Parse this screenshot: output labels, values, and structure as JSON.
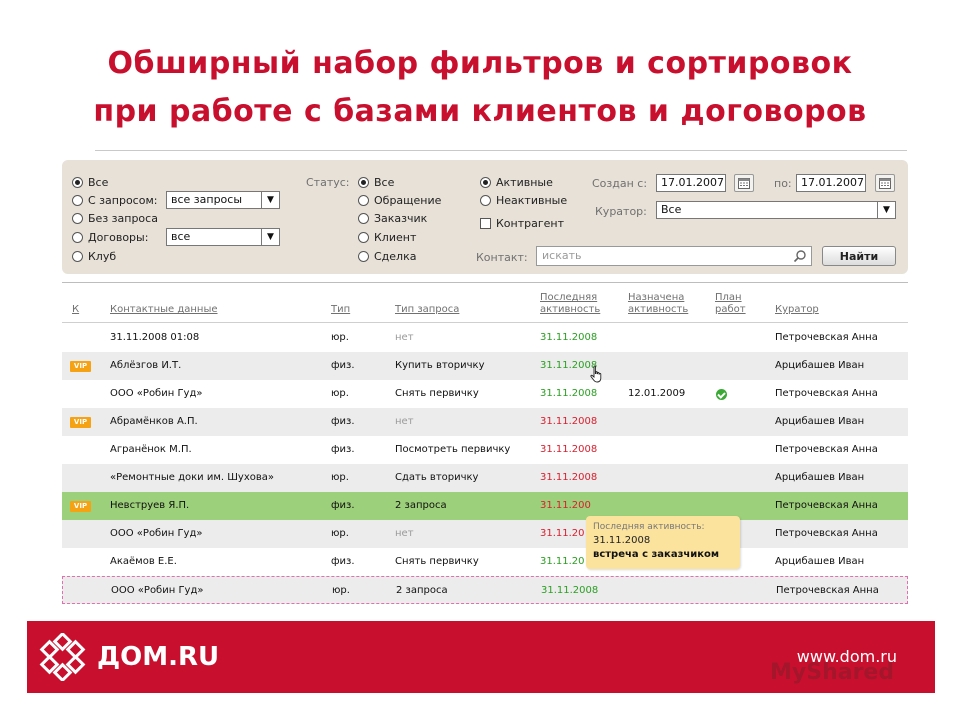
{
  "slide": {
    "title_line1": "Обширный набор фильтров и сортировок",
    "title_line2": "при работе с базами клиентов и договоров"
  },
  "filters": {
    "type_group": [
      {
        "label": "Все",
        "checked": true
      },
      {
        "label": "С запросом:",
        "checked": false
      },
      {
        "label": "Без запроса",
        "checked": false
      },
      {
        "label": "Договоры:",
        "checked": false
      },
      {
        "label": "Клуб",
        "checked": false
      }
    ],
    "request_select_value": "все запросы",
    "contracts_select_value": "все",
    "status_label": "Статус:",
    "status_group": [
      {
        "label": "Все",
        "checked": true
      },
      {
        "label": "Обращение",
        "checked": false
      },
      {
        "label": "Заказчик",
        "checked": false
      },
      {
        "label": "Клиент",
        "checked": false
      },
      {
        "label": "Сделка",
        "checked": false
      }
    ],
    "activity_group": [
      {
        "label": "Активные",
        "checked": true
      },
      {
        "label": "Неактивные",
        "checked": false
      }
    ],
    "counterparty_label": "Контрагент",
    "created_from_label": "Создан с:",
    "created_from_value": "17.01.2007",
    "created_to_label": "по:",
    "created_to_value": "17.01.2007",
    "curator_label": "Куратор:",
    "curator_value": "Все",
    "contact_label": "Контакт:",
    "search_placeholder": "искать",
    "find_button": "Найти"
  },
  "table": {
    "columns": [
      "К",
      "Контактные данные",
      "Тип",
      "Тип запроса",
      "Последняя\nактивность",
      "Назначена\nактивность",
      "План\nработ",
      "Куратор"
    ],
    "rows": [
      {
        "vip": "",
        "contact": "31.11.2008 01:08",
        "type": "юр.",
        "request": "нет",
        "request_muted": true,
        "last": "31.11.2008",
        "last_status": "green",
        "assigned": "",
        "plan_done": false,
        "curator": "Петрочевская Анна"
      },
      {
        "vip": "VIP",
        "contact": "Аблёзгов И.Т.",
        "type": "физ.",
        "request": "Купить вторичку",
        "request_muted": false,
        "last": "31.11.2008",
        "last_status": "green",
        "assigned": "",
        "plan_done": false,
        "curator": "Арцибашев Иван"
      },
      {
        "vip": "",
        "contact": "ООО «Робин Гуд»",
        "type": "юр.",
        "request": "Снять первичку",
        "request_muted": false,
        "last": "31.11.2008",
        "last_status": "green",
        "assigned": "12.01.2009",
        "plan_done": true,
        "curator": "Петрочевская Анна"
      },
      {
        "vip": "VIP",
        "contact": "Абрамёнков А.П.",
        "type": "физ.",
        "request": "нет",
        "request_muted": true,
        "last": "31.11.2008",
        "last_status": "red",
        "assigned": "",
        "plan_done": false,
        "curator": "Арцибашев Иван"
      },
      {
        "vip": "",
        "contact": "Агранёнок М.П.",
        "type": "физ.",
        "request": "Посмотреть первичку",
        "request_muted": false,
        "last": "31.11.2008",
        "last_status": "red",
        "assigned": "",
        "plan_done": false,
        "curator": "Петрочевская Анна"
      },
      {
        "vip": "",
        "contact": "«Ремонтные доки им. Шухова»",
        "type": "юр.",
        "request": "Сдать вторичку",
        "request_muted": false,
        "last": "31.11.2008",
        "last_status": "red",
        "assigned": "",
        "plan_done": false,
        "curator": "Арцибашев Иван"
      },
      {
        "vip": "VIP",
        "contact": "Невструев Я.П.",
        "type": "физ.",
        "request": "2 запроса",
        "request_muted": false,
        "last": "31.11.200",
        "last_status": "red",
        "assigned": "",
        "plan_done": false,
        "curator": "Петрочевская Анна"
      },
      {
        "vip": "",
        "contact": "ООО «Робин Гуд»",
        "type": "юр.",
        "request": "нет",
        "request_muted": true,
        "last": "31.11.20",
        "last_status": "red",
        "assigned": "",
        "plan_done": false,
        "curator": "Петрочевская Анна"
      },
      {
        "vip": "",
        "contact": "Акаёмов Е.Е.",
        "type": "физ.",
        "request": "Снять первичку",
        "request_muted": false,
        "last": "31.11.20",
        "last_status": "green",
        "assigned": "",
        "plan_done": false,
        "curator": "Арцибашев Иван"
      },
      {
        "vip": "",
        "contact": "ООО «Робин Гуд»",
        "type": "юр.",
        "request": "2 запроса",
        "request_muted": false,
        "last": "31.11.2008",
        "last_status": "green",
        "assigned": "",
        "plan_done": false,
        "curator": "Петрочевская Анна"
      }
    ]
  },
  "tooltip": {
    "title": "Последняя активность:",
    "date": "31.11.2008",
    "description": "встреча с заказчиком"
  },
  "footer": {
    "logo_text": "ДОМ.RU",
    "url": "www.dom.ru"
  },
  "watermark": "MyShared",
  "colors": {
    "brand_red": "#c8102e",
    "panel_bg": "#e7e1d7",
    "selected_row": "#9dd07a",
    "vip_badge": "#f5a314",
    "activity_green": "#2aa022",
    "activity_red": "#d8202e",
    "tooltip_bg": "#fbe39e"
  }
}
